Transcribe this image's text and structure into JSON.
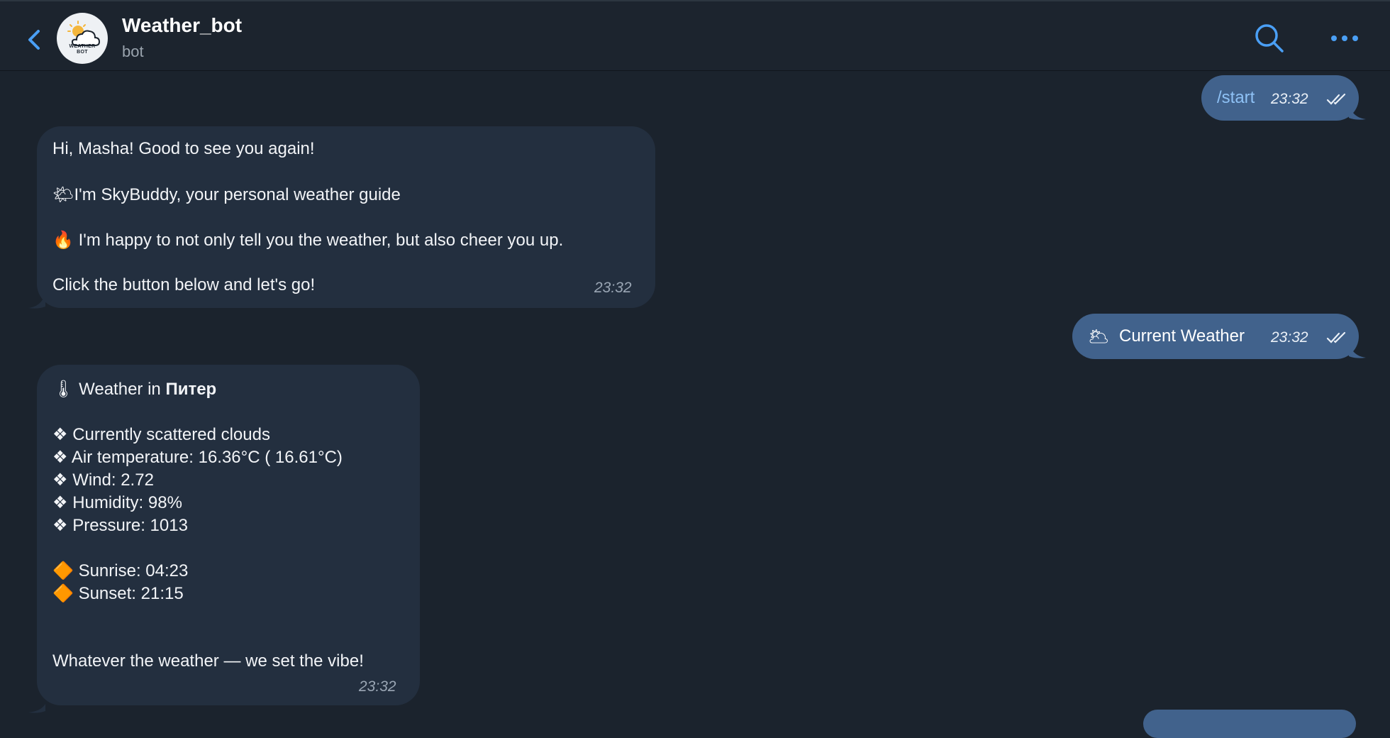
{
  "header": {
    "title": "Weather_bot",
    "subtitle": "bot",
    "avatar_text_1": "WEATHER",
    "avatar_text_2": "BOT"
  },
  "colors": {
    "background": "#1b232d",
    "incoming_bubble": "#232f3f",
    "outgoing_bubble": "#41628c",
    "accent": "#4a9ff5"
  },
  "messages": {
    "start": {
      "text": "/start",
      "time": "23:32"
    },
    "greeting": {
      "line1": "Hi, Masha! Good to see you again!",
      "line2_emoji": "🌤",
      "line2": "I'm SkyBuddy, your personal weather guide",
      "line3_emoji": "🔥",
      "line3": "I'm happy to not only tell you the weather, but also cheer you up.",
      "line4": "Click the button below and let's go!",
      "time": "23:32"
    },
    "current_weather": {
      "emoji": "🌥",
      "text": "Current Weather",
      "time": "23:32"
    },
    "report": {
      "title_emoji": "🌡",
      "title_prefix": "Weather in ",
      "city": "Питер",
      "bullet": "❖",
      "items": [
        "Currently scattered clouds",
        "Air temperature: 16.36°C ( 16.61°C)",
        "Wind: 2.72",
        "Humidity: 98%",
        "Pressure: 1013"
      ],
      "sun_bullet": "🔶",
      "sunrise": "Sunrise: 04:23",
      "sunset": "Sunset: 21:15",
      "footer": "Whatever the weather — we set the vibe!",
      "time": "23:32"
    }
  }
}
